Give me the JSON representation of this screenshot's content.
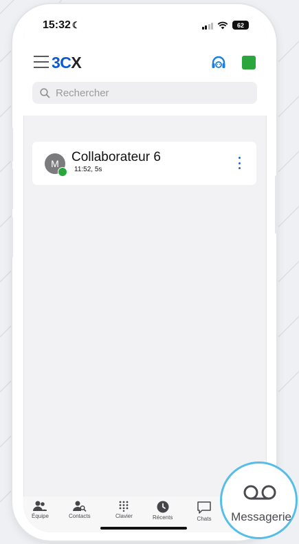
{
  "status_bar": {
    "time": "15:32",
    "battery": "62"
  },
  "header": {
    "logo": {
      "part1": "3",
      "part2": "C",
      "part3": "X"
    }
  },
  "search": {
    "placeholder": "Rechercher"
  },
  "contact": {
    "avatar_initial": "M",
    "name": "Collaborateur 6",
    "time_duration": "11:52, 5s",
    "presence_color": "#2aa63c"
  },
  "tabbar": {
    "tabs": [
      {
        "label": "Équipe",
        "icon": "team-icon"
      },
      {
        "label": "Contacts",
        "icon": "contacts-icon"
      },
      {
        "label": "Clavier",
        "icon": "keypad-icon"
      },
      {
        "label": "Récents",
        "icon": "clock-icon"
      },
      {
        "label": "Chats",
        "icon": "chat-icon"
      }
    ],
    "highlighted": {
      "label": "Messagerie",
      "icon": "voicemail-icon"
    }
  },
  "colors": {
    "accent": "#0a5bd3",
    "status_green": "#2aa63c",
    "highlight_ring": "#56bde6"
  }
}
